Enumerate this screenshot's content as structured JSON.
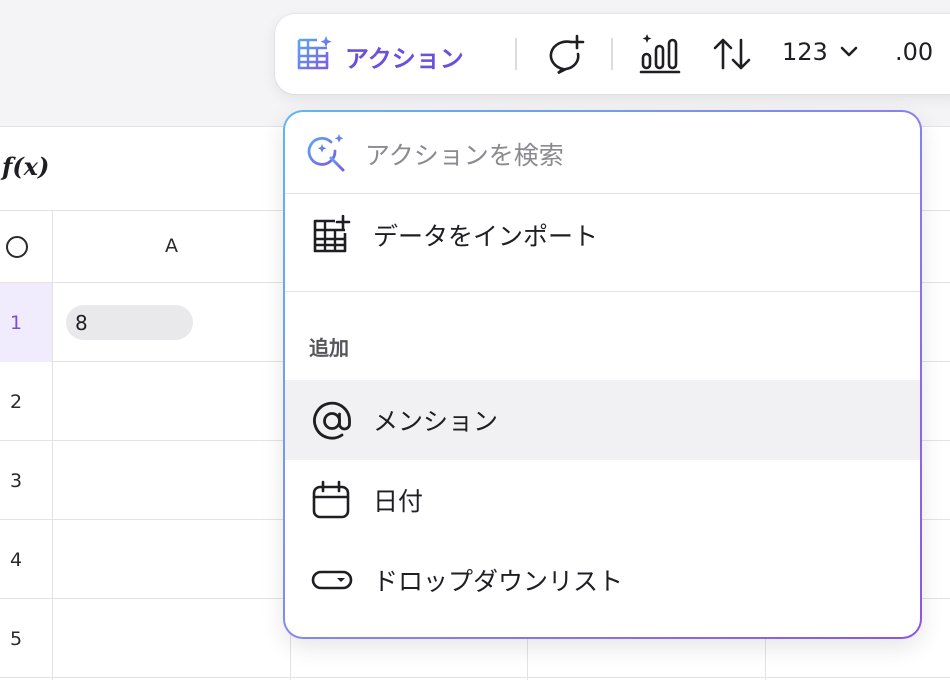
{
  "toolbar": {
    "action_label": "アクション",
    "number_format": "123",
    "decimal": ".00",
    "icons": [
      "table-sparkle-icon",
      "comment-plus-icon",
      "chart-sparkle-icon",
      "sort-icon",
      "chevron-down-icon"
    ],
    "accent": "#6b4fe0"
  },
  "formula_bar": {
    "fx": "f(x)"
  },
  "sheet": {
    "column_a": "A",
    "rows": [
      "1",
      "2",
      "3",
      "4",
      "5"
    ],
    "cell_a1": "8",
    "active_row_color": "#7c4ddb"
  },
  "menu": {
    "search_placeholder": "アクションを検索",
    "import_label": "データをインポート",
    "section_add": "追加",
    "mention_label": "メンション",
    "date_label": "日付",
    "dropdown_label": "ドロップダウンリスト"
  }
}
